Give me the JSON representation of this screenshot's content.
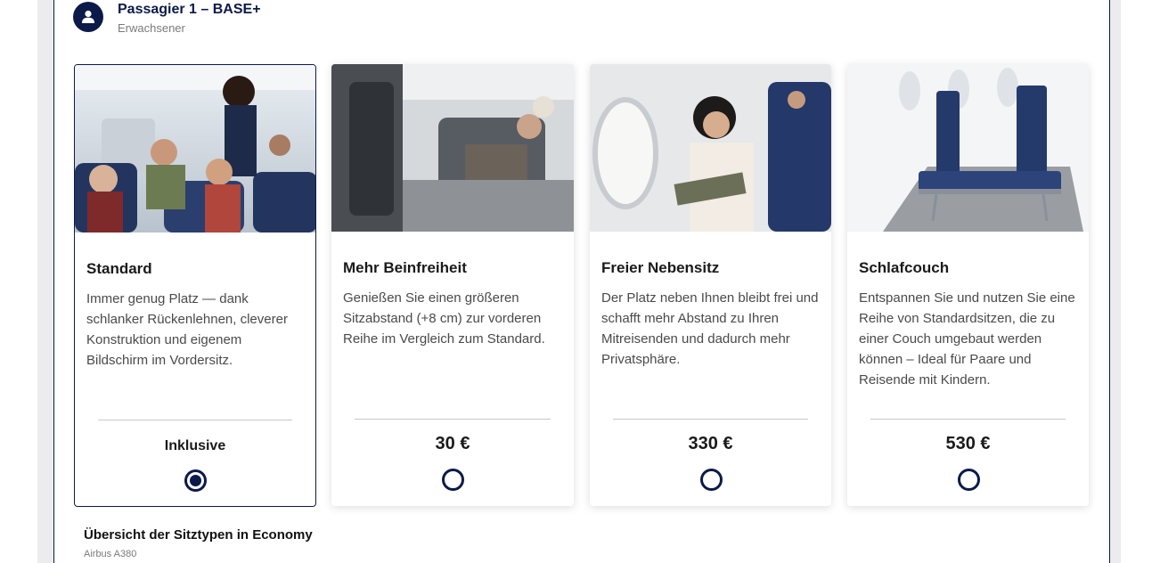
{
  "passenger": {
    "name": "Passagier 1 – BASE+",
    "type": "Erwachsener",
    "icon": "user-icon"
  },
  "seat_options": [
    {
      "id": "standard",
      "title": "Standard",
      "description": "Immer genug Platz — dank schlanker Rückenlehnen, cleverer Konstruktion und eigenem Bildschirm im Vordersitz.",
      "price": "Inklusive",
      "selected": true
    },
    {
      "id": "legroom",
      "title": "Mehr Beinfreiheit",
      "description": "Genießen Sie einen größeren Sitzabstand (+8 cm) zur vorderen Reihe im Vergleich zum Standard.",
      "price": "30 €",
      "selected": false
    },
    {
      "id": "free-neighbor",
      "title": "Freier Nebensitz",
      "description": "Der Platz neben Ihnen bleibt frei und schafft mehr Abstand zu Ihren Mitreisenden und dadurch mehr Privatsphäre.",
      "price": "330 €",
      "selected": false
    },
    {
      "id": "sleeper",
      "title": "Schlafcouch",
      "description": "Entspannen Sie und nutzen Sie eine Reihe von Standardsitzen, die zu einer Couch umgebaut werden können – Ideal für Paare und Reisende mit Kindern.",
      "price": "530 €",
      "selected": false
    }
  ],
  "overview": {
    "title": "Übersicht der Sitztypen in Economy",
    "aircraft": "Airbus A380"
  },
  "colors": {
    "brand_navy": "#0c1a4a",
    "seat_blue": "#243a6b"
  }
}
